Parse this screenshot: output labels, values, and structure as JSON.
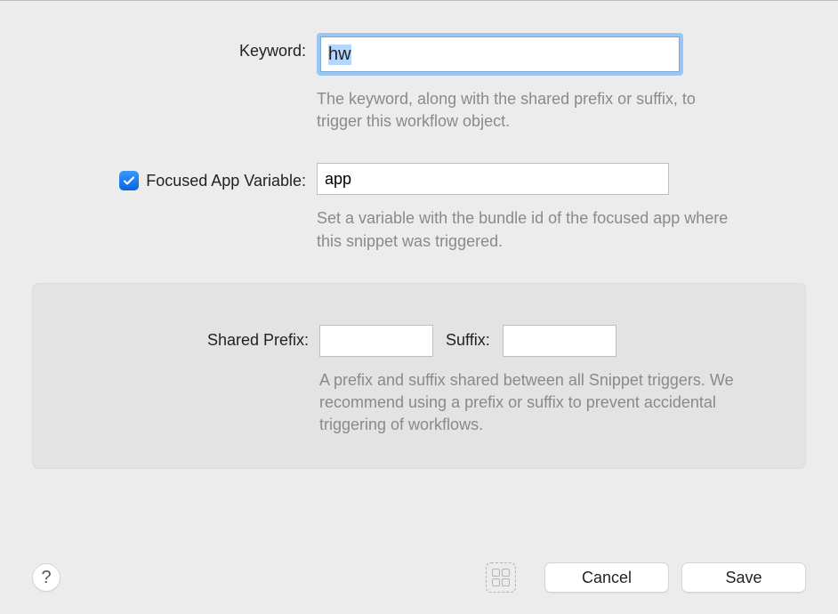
{
  "keyword": {
    "label": "Keyword:",
    "value": "hw",
    "help": "The keyword, along with the shared prefix or suffix, to trigger this workflow object."
  },
  "focused_app": {
    "checked": true,
    "label": "Focused App Variable:",
    "value": "app",
    "help": "Set a variable with the bundle id of the focused app where this snippet was triggered."
  },
  "shared": {
    "prefix_label": "Shared Prefix:",
    "prefix_value": "",
    "suffix_label": "Suffix:",
    "suffix_value": "",
    "help": "A prefix and suffix shared between all Snippet triggers. We recommend using a prefix or suffix to prevent accidental triggering of workflows."
  },
  "footer": {
    "help_label": "?",
    "cancel": "Cancel",
    "save": "Save"
  }
}
